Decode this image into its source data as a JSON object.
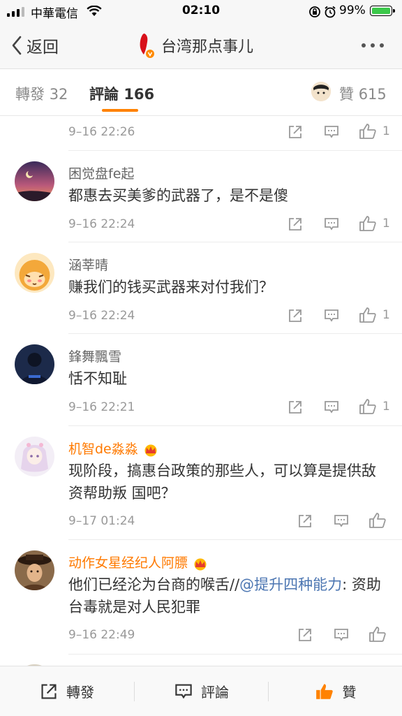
{
  "status_bar": {
    "carrier": "中華電信",
    "time": "02:10",
    "battery_pct": "99%"
  },
  "nav": {
    "back_label": "返回",
    "title": "台湾那点事儿"
  },
  "tabs": {
    "repost_label": "轉發",
    "repost_count": "32",
    "comment_label": "評論",
    "comment_count": "166",
    "like_label": "贊",
    "like_count": "615"
  },
  "partial_row": {
    "time": "9–16 22:26",
    "like_count": "1"
  },
  "comments": [
    {
      "user": "困觉盘fe起",
      "text": "都惠去买美爹的武器了，是不是傻",
      "time": "9–16 22:24",
      "like_count": "1"
    },
    {
      "user": "涵莘晴",
      "text": "赚我们的钱买武器来对付我们？",
      "time": "9–16 22:24",
      "like_count": "1"
    },
    {
      "user": "鋒舞飄雪",
      "text": "恬不知耻",
      "time": "9–16 22:21",
      "like_count": "1"
    },
    {
      "user": "机智de淼淼",
      "text": "现阶段，搞惠台政策的那些人，可以算是提供敌资帮助叛 国吧？",
      "time": "9–17 01:24",
      "like_count": ""
    },
    {
      "user": "动作女星经纪人阿膘",
      "text_before": "他们已经沦为台商的喉舌//",
      "mention": "@提升四种能力",
      "text_after": ": 资助台毒就是对人民犯罪",
      "time": "9–16 22:49",
      "like_count": ""
    }
  ],
  "bottom_bar": {
    "repost": "轉發",
    "comment": "評論",
    "like": "贊"
  },
  "colors": {
    "accent": "#ff8200",
    "vip_name": "#ff7a00",
    "mention": "#4c76b2"
  }
}
